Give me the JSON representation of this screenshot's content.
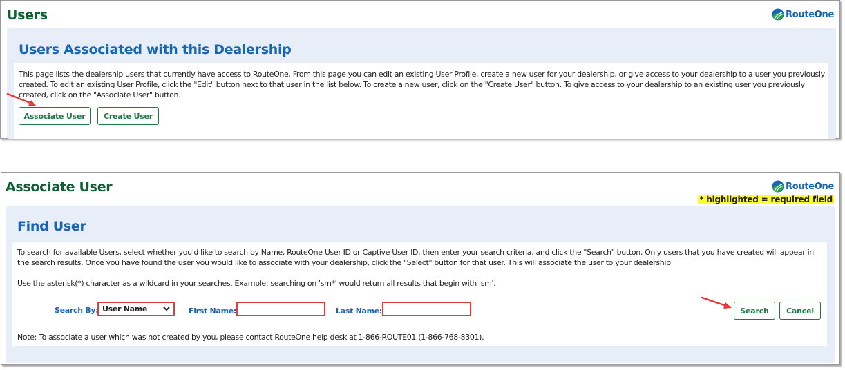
{
  "users_panel": {
    "title": "Users",
    "logo_text": "RouteOne",
    "section_title": "Users Associated with this Dealership",
    "description": "This page lists the dealership users that currently have access to RouteOne. From this page you can edit an existing User Profile, create a new user for your dealership, or give access to your dealership to a user you previously created. To edit an existing User Profile, click the \"Edit\" button next to that user in the list below. To create a new user, click on the \"Create User\" button. To give access to your dealership to an existing user you previously created, click on the \"Associate User\" button.",
    "buttons": {
      "associate_user": "Associate User",
      "create_user": "Create User"
    }
  },
  "associate_panel": {
    "title": "Associate User",
    "logo_text": "RouteOne",
    "required_note": "* highlighted = required field",
    "section_title": "Find User",
    "description": "To search for available Users, select whether you'd like to search by Name, RouteOne User ID or Captive User ID, then enter your search criteria, and click the \"Search\" button. Only users that you have created will appear in the search results. Once you have found the user you would like to associate with your dealership, click the \"Select\" button for that user. This will associate the user to your dealership.",
    "wildcard_note": "Use the asterisk(*) character as a wildcard in your searches. Example: searching on 'sm*' would return all results that begin with 'sm'.",
    "form": {
      "search_by_label": "Search By:",
      "search_by_value": "User Name",
      "first_name_label": "First Name:",
      "first_name_value": "",
      "last_name_label": "Last Name:",
      "last_name_value": ""
    },
    "buttons": {
      "search": "Search",
      "cancel": "Cancel"
    },
    "note": "Note: To associate a user which was not created by you, please contact RouteOne help desk at 1-866-ROUTE01 (1-866-768-8301)."
  },
  "colors": {
    "title_green": "#0f5e34",
    "section_blue": "#1a64b4",
    "button_green": "#1f7a43",
    "required_border": "#e23b3b",
    "highlight_yellow": "#ffff33",
    "annotation_arrow": "#e53935"
  }
}
